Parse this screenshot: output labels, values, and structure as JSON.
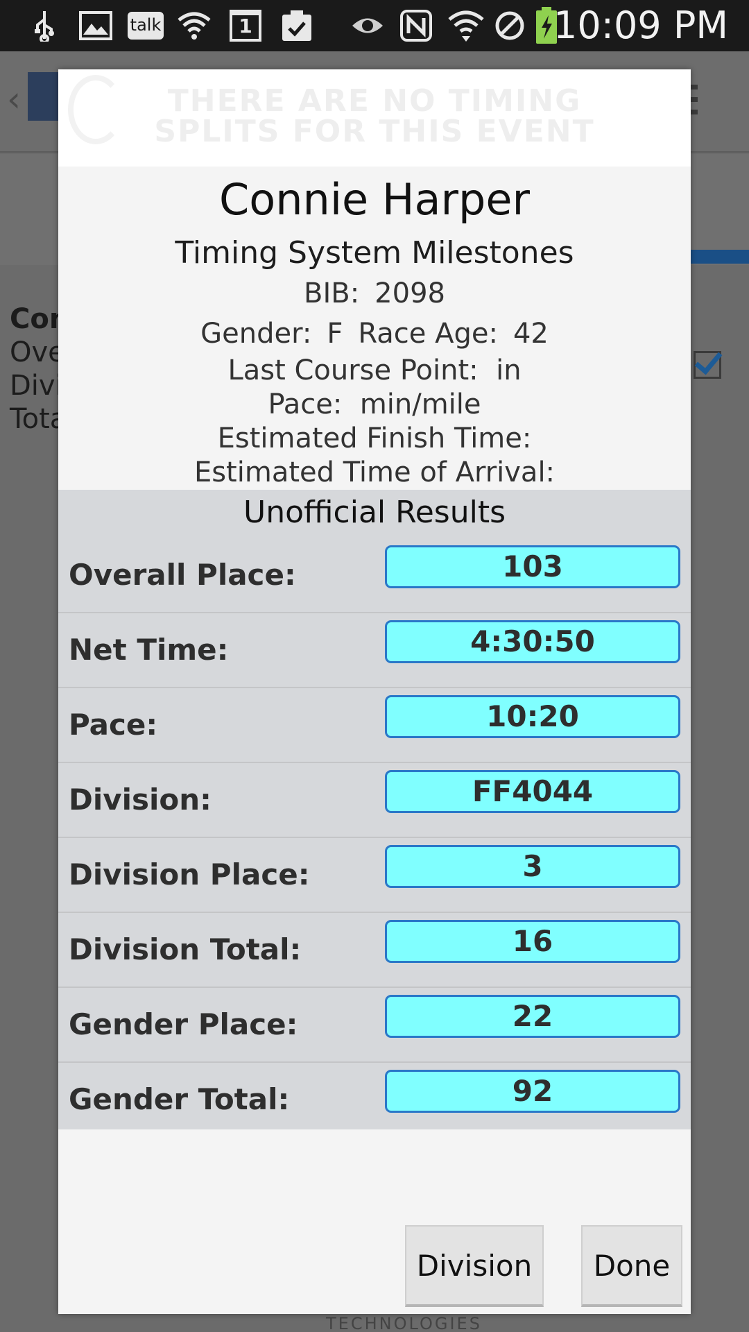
{
  "status_bar": {
    "icons": [
      "usb-icon",
      "image-icon",
      "talk-icon",
      "wifi-question-icon",
      "calendar-icon",
      "clipboard-check-icon",
      "eye-icon",
      "nfc-icon",
      "wifi-icon",
      "no-sim-icon",
      "battery-charging-icon"
    ],
    "talk_label": "talk",
    "calendar_day": "1",
    "time": "10:09 PM"
  },
  "background": {
    "banner_text_line1": "THERE ARE NO TIMING",
    "banner_text_line2": "SPLITS FOR THIS EVENT",
    "lines": [
      "Con",
      "Ove",
      "Divi",
      "Tota"
    ],
    "footer": "TECHNOLOGIES"
  },
  "dialog": {
    "name": "Connie Harper",
    "subtitle": "Timing System Milestones",
    "bib_label": "BIB:",
    "bib_value": "2098",
    "gender_label": "Gender:",
    "gender_value": "F",
    "age_label": "Race Age:",
    "age_value": "42",
    "last_point_label": "Last Course Point:",
    "last_point_value": "in",
    "pace_label": "Pace:",
    "pace_value": "min/mile",
    "finish_label": "Estimated Finish Time:",
    "arrival_label": "Estimated Time of Arrival:",
    "results_title": "Unofficial Results",
    "results": [
      {
        "label": "Overall Place:",
        "value": "103"
      },
      {
        "label": "Net Time:",
        "value": "4:30:50"
      },
      {
        "label": "Pace:",
        "value": "10:20"
      },
      {
        "label": "Division:",
        "value": "FF4044"
      },
      {
        "label": "Division Place:",
        "value": "3"
      },
      {
        "label": "Division Total:",
        "value": "16"
      },
      {
        "label": "Gender Place:",
        "value": "22"
      },
      {
        "label": "Gender Total:",
        "value": "92"
      }
    ],
    "division_button": "Division",
    "done_button": "Done"
  }
}
